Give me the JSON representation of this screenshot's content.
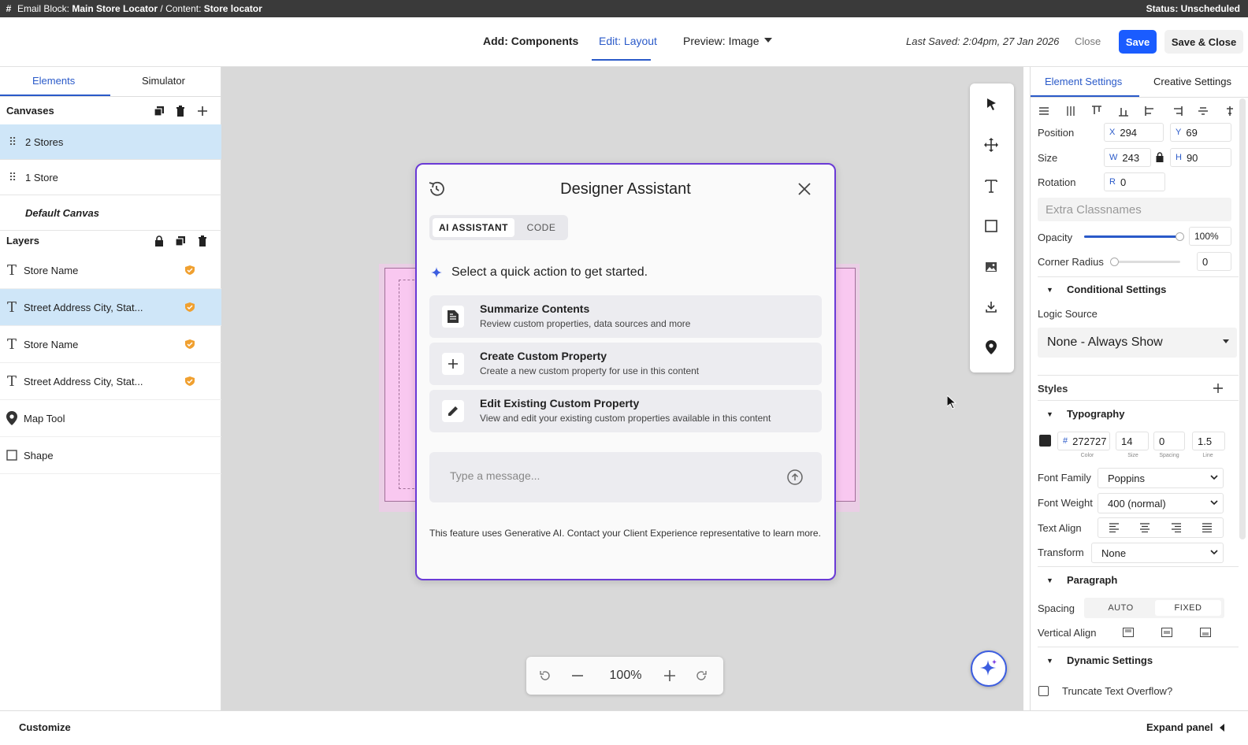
{
  "topbar": {
    "block_prefix": "Email Block:",
    "block_name": "Main Store Locator",
    "content_prefix": "/ Content:",
    "content_name": "Store locator",
    "status": "Status: Unscheduled"
  },
  "header": {
    "tabs": [
      {
        "label": "Add: Components"
      },
      {
        "label": "Edit: Layout"
      },
      {
        "label": "Preview: Image"
      }
    ],
    "last_saved": "Last Saved: 2:04pm, 27 Jan 2026",
    "close": "Close",
    "save": "Save",
    "save_close": "Save & Close"
  },
  "left": {
    "tabs": [
      "Elements",
      "Simulator"
    ],
    "canvases_title": "Canvases",
    "canvases": [
      "2 Stores",
      "1 Store",
      "Default Canvas"
    ],
    "layers_title": "Layers",
    "layers": [
      "Store Name",
      "Street Address City, Stat...",
      "Store Name",
      "Street Address City, Stat...",
      "Map Tool",
      "Shape"
    ]
  },
  "dialog": {
    "title": "Designer Assistant",
    "tab_ai": "AI ASSISTANT",
    "tab_code": "CODE",
    "prompt": "Select a quick action to get started.",
    "actions": [
      {
        "title": "Summarize Contents",
        "desc": "Review custom properties, data sources and more",
        "icon": "document-icon"
      },
      {
        "title": "Create Custom Property",
        "desc": "Create a new custom property for use in this content",
        "icon": "plus-icon"
      },
      {
        "title": "Edit Existing Custom Property",
        "desc": "View and edit your existing custom properties available in this content",
        "icon": "pencil-icon"
      }
    ],
    "placeholder": "Type a message...",
    "footer": "This feature uses Generative AI. Contact your Client Experience representative to learn more."
  },
  "zoom": {
    "level": "100%"
  },
  "right": {
    "tabs": [
      "Element Settings",
      "Creative Settings"
    ],
    "position_label": "Position",
    "x_prefix": "X",
    "x": "294",
    "y_prefix": "Y",
    "y": "69",
    "size_label": "Size",
    "w_prefix": "W",
    "w": "243",
    "h_prefix": "H",
    "h": "90",
    "rotation_label": "Rotation",
    "r_prefix": "R",
    "r": "0",
    "classnames_placeholder": "Extra Classnames",
    "opacity_label": "Opacity",
    "opacity": "100%",
    "opacity_fraction": 1.0,
    "corner_label": "Corner Radius",
    "corner": "0",
    "corner_fraction": 0.0,
    "conditional_title": "Conditional Settings",
    "logic_label": "Logic Source",
    "logic_value": "None - Always Show",
    "styles_title": "Styles",
    "typography_title": "Typography",
    "color_hex": "272727",
    "color_hash": "#",
    "font_size": "14",
    "spacing": "0",
    "line": "1.5",
    "mini_labels": {
      "color": "Color",
      "size": "Size",
      "spacing": "Spacing",
      "line": "Line"
    },
    "font_family_label": "Font Family",
    "font_family": "Poppins",
    "font_weight_label": "Font Weight",
    "font_weight": "400 (normal)",
    "text_align_label": "Text Align",
    "transform_label": "Transform",
    "transform": "None",
    "paragraph_title": "Paragraph",
    "spacing_label": "Spacing",
    "spacing_auto": "AUTO",
    "spacing_fixed": "FIXED",
    "valign_label": "Vertical Align",
    "dynamic_title": "Dynamic Settings",
    "truncate_label": "Truncate Text Overflow?"
  },
  "bottom": {
    "customize": "Customize",
    "expand": "Expand panel"
  },
  "colors": {
    "accent": "#2a5ac9",
    "save": "#1a5cff",
    "dialog_border": "#6a3ad6",
    "selected_row": "#cfe6f8"
  }
}
